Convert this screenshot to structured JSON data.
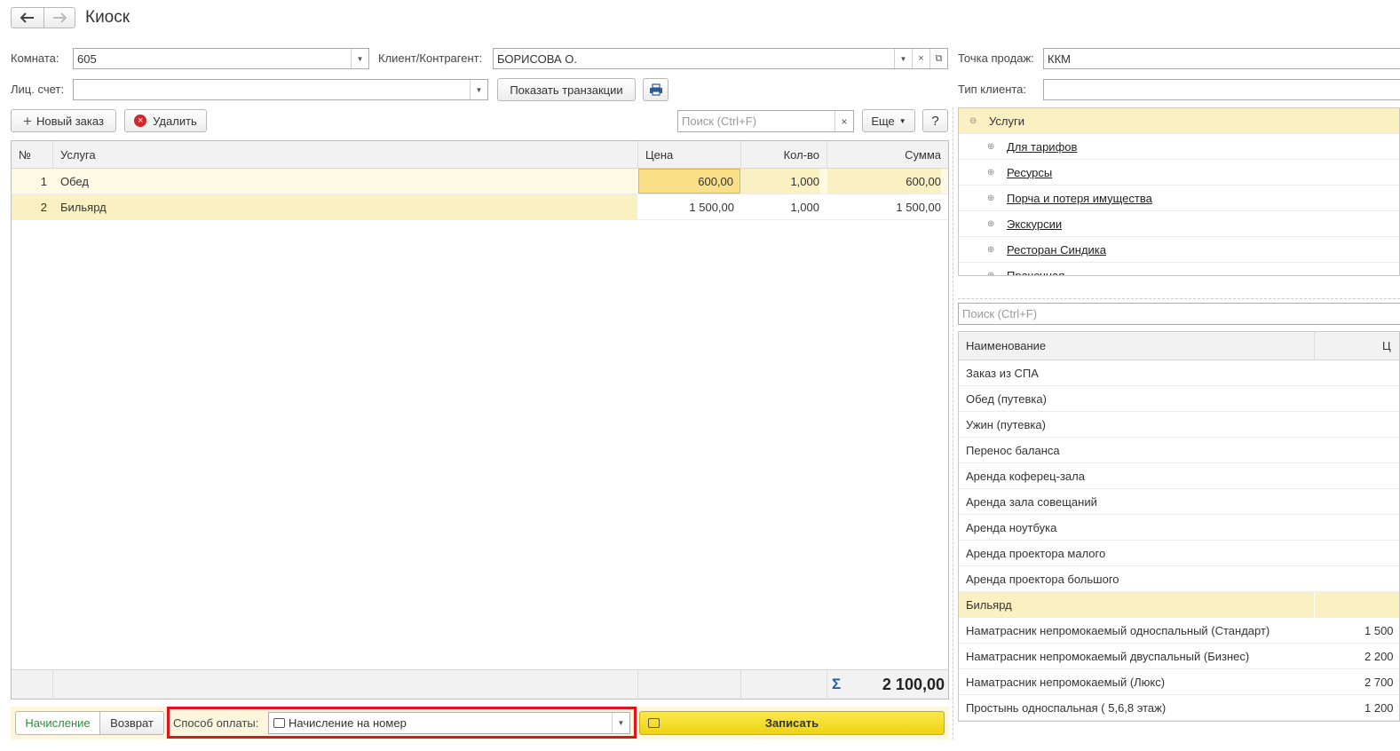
{
  "window": {
    "title": "Киоск"
  },
  "nav": {
    "back_icon": "arrow-left-icon",
    "forward_icon": "arrow-right-icon"
  },
  "form": {
    "room_label": "Комната:",
    "room_value": "605",
    "client_label": "Клиент/Контрагент:",
    "client_value": "БОРИСОВА О.",
    "account_label": "Лиц. счет:",
    "account_value": "",
    "show_transactions": "Показать транзакции",
    "point_label": "Точка продаж:",
    "point_value": "ККМ",
    "client_type_label": "Тип клиента:",
    "client_type_value": ""
  },
  "toolbar": {
    "new_order": "Новый заказ",
    "delete": "Удалить",
    "search_placeholder": "Поиск (Ctrl+F)",
    "more": "Еще",
    "help": "?"
  },
  "table": {
    "columns": [
      "№",
      "Услуга",
      "Цена",
      "Кол-во",
      "Сумма"
    ],
    "rows": [
      {
        "num": "1",
        "service": "Обед",
        "price": "600,00",
        "qty": "1,000",
        "sum": "600,00"
      },
      {
        "num": "2",
        "service": "Бильярд",
        "price": "1 500,00",
        "qty": "1,000",
        "sum": "1 500,00"
      }
    ],
    "total": "2 100,00"
  },
  "footer": {
    "tab_charge": "Начисление",
    "tab_return": "Возврат",
    "payment_label": "Способ оплаты:",
    "payment_value": "Начисление на номер",
    "save": "Записать"
  },
  "tree": {
    "root": "Услуги",
    "items": [
      "Для тарифов ",
      "Ресурсы ",
      "Порча и потеря имущества",
      "Экскурсии",
      "Ресторан Синдика ",
      "Прачечная"
    ]
  },
  "products": {
    "search_placeholder": "Поиск (Ctrl+F)",
    "col_name": "Наименование",
    "col_price": "Ц",
    "rows": [
      {
        "name": "Заказ из СПА",
        "price": ""
      },
      {
        "name": "Обед (путевка)",
        "price": ""
      },
      {
        "name": "Ужин (путевка)",
        "price": ""
      },
      {
        "name": "Перенос баланса",
        "price": ""
      },
      {
        "name": "Аренда коферец-зала",
        "price": ""
      },
      {
        "name": "Аренда зала совещаний",
        "price": ""
      },
      {
        "name": "Аренда ноутбука",
        "price": ""
      },
      {
        "name": "Аренда проектора малого",
        "price": ""
      },
      {
        "name": "Аренда проектора большого",
        "price": ""
      },
      {
        "name": "Бильярд",
        "price": ""
      },
      {
        "name": "Наматрасник непромокаемый односпальный (Стандарт)",
        "price": "1 500"
      },
      {
        "name": "Наматрасник непромокаемый двуспальный (Бизнес)",
        "price": "2 200"
      },
      {
        "name": "Наматрасник непромокаемый (Люкс)",
        "price": "2 700"
      },
      {
        "name": "Простынь односпальная ( 5,6,8 этаж)",
        "price": "1 200"
      }
    ]
  },
  "colors": {
    "accent_yellow": "#f5dc27",
    "highlight_red": "#e0141b",
    "selected_row": "#fbf0c2",
    "green_tab": "#2e8b3e"
  }
}
